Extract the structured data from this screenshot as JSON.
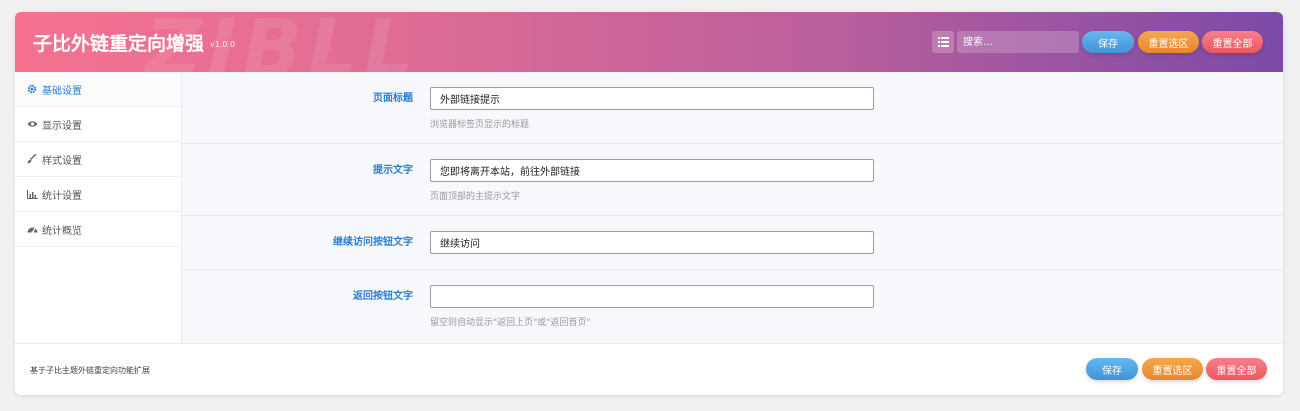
{
  "header": {
    "title": "子比外链重定向增强",
    "version": "v1.0.0",
    "watermark": "ZIBLL",
    "search": {
      "placeholder": "搜索..."
    },
    "buttons": {
      "save": "保存",
      "reset_section": "重置选区",
      "reset_all": "重置全部"
    }
  },
  "sidebar": {
    "items": [
      {
        "label": "基础设置",
        "icon": "gear-icon",
        "active": true
      },
      {
        "label": "显示设置",
        "icon": "eye-icon",
        "active": false
      },
      {
        "label": "样式设置",
        "icon": "brush-icon",
        "active": false
      },
      {
        "label": "统计设置",
        "icon": "bar-chart-icon",
        "active": false
      },
      {
        "label": "统计概览",
        "icon": "dashboard-icon",
        "active": false
      }
    ]
  },
  "fields": [
    {
      "label": "页面标题",
      "value": "外部链接提示",
      "description": "浏览器标签页显示的标题"
    },
    {
      "label": "提示文字",
      "value": "您即将离开本站，前往外部链接",
      "description": "页面顶部的主提示文字"
    },
    {
      "label": "继续访问按钮文字",
      "value": "继续访问",
      "description": ""
    },
    {
      "label": "返回按钮文字",
      "value": "",
      "description": "留空则自动显示\"返回上页\"或\"返回首页\""
    }
  ],
  "footer": {
    "text": "基于子比主题外链重定向功能扩展",
    "buttons": {
      "save": "保存",
      "reset_section": "重置选区",
      "reset_all": "重置全部"
    }
  },
  "colors": {
    "header_gradient_start": "#f5728f",
    "header_gradient_end": "#7d4aa8",
    "accent": "#2b7fd0",
    "save": "#4ea3e3",
    "reset_section": "#ef963a",
    "reset_all": "#f26a73"
  }
}
